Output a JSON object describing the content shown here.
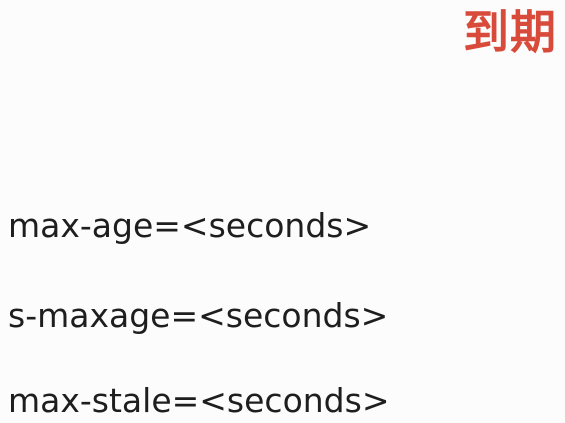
{
  "slide": {
    "title": "到期",
    "title_color": "#d84a3a",
    "directives": [
      "max-age=<seconds>",
      "s-maxage=<seconds>",
      "max-stale=<seconds>"
    ]
  }
}
